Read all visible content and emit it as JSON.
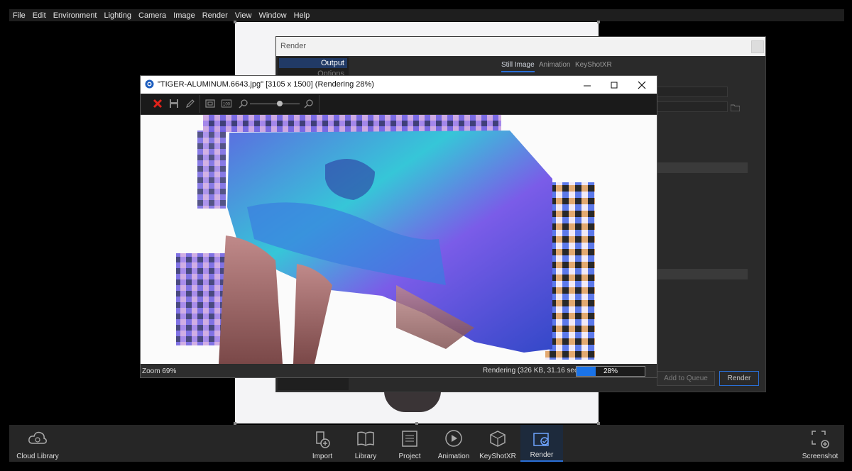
{
  "menu": [
    "File",
    "Edit",
    "Environment",
    "Lighting",
    "Camera",
    "Image",
    "Render",
    "View",
    "Window",
    "Help"
  ],
  "render_dialog": {
    "title": "Render",
    "side_items": [
      "Output",
      "Options"
    ],
    "tabs": [
      "Still Image",
      "Animation",
      "KeyShotXR"
    ],
    "add_to_queue": "Add to Queue",
    "render": "Render"
  },
  "image_window": {
    "title": "\"TIGER-ALUMINUM.6643.jpg\" [3105 x 1500] (Rendering 28%)",
    "zoom": "Zoom 69%",
    "rendering_info": "Rendering (326 KB, 31.16 sec)",
    "progress_text": "28%",
    "progress": 0.28
  },
  "dock": {
    "cloud_library": "Cloud Library",
    "import": "Import",
    "library": "Library",
    "project": "Project",
    "animation": "Animation",
    "keyshotxr": "KeyShotXR",
    "render": "Render",
    "screenshot": "Screenshot"
  },
  "colors": {
    "accent": "#2a6fd6",
    "progress": "#1a73e8"
  }
}
